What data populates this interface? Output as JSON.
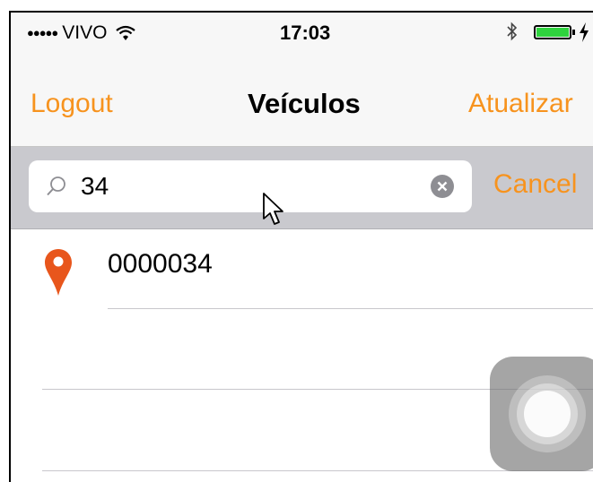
{
  "status_bar": {
    "signal_dots": "●●●●●",
    "carrier": "VIVO",
    "time": "17:03",
    "icons": [
      "wifi-icon",
      "bluetooth-icon",
      "battery-icon",
      "charging-icon"
    ]
  },
  "nav_bar": {
    "left_button": "Logout",
    "title": "Veículos",
    "right_button": "Atualizar"
  },
  "search": {
    "value": "34",
    "icons": [
      "search-icon",
      "clear-icon"
    ],
    "cancel_label": "Cancel"
  },
  "results": [
    {
      "label": "0000034",
      "icon": "map-pin-icon"
    }
  ],
  "colors": {
    "accent": "#f7931e",
    "pin": "#e8561c",
    "search_bar_bg": "#c9c9ce",
    "nav_bg": "#f7f7f7",
    "battery": "#2fd33e"
  }
}
